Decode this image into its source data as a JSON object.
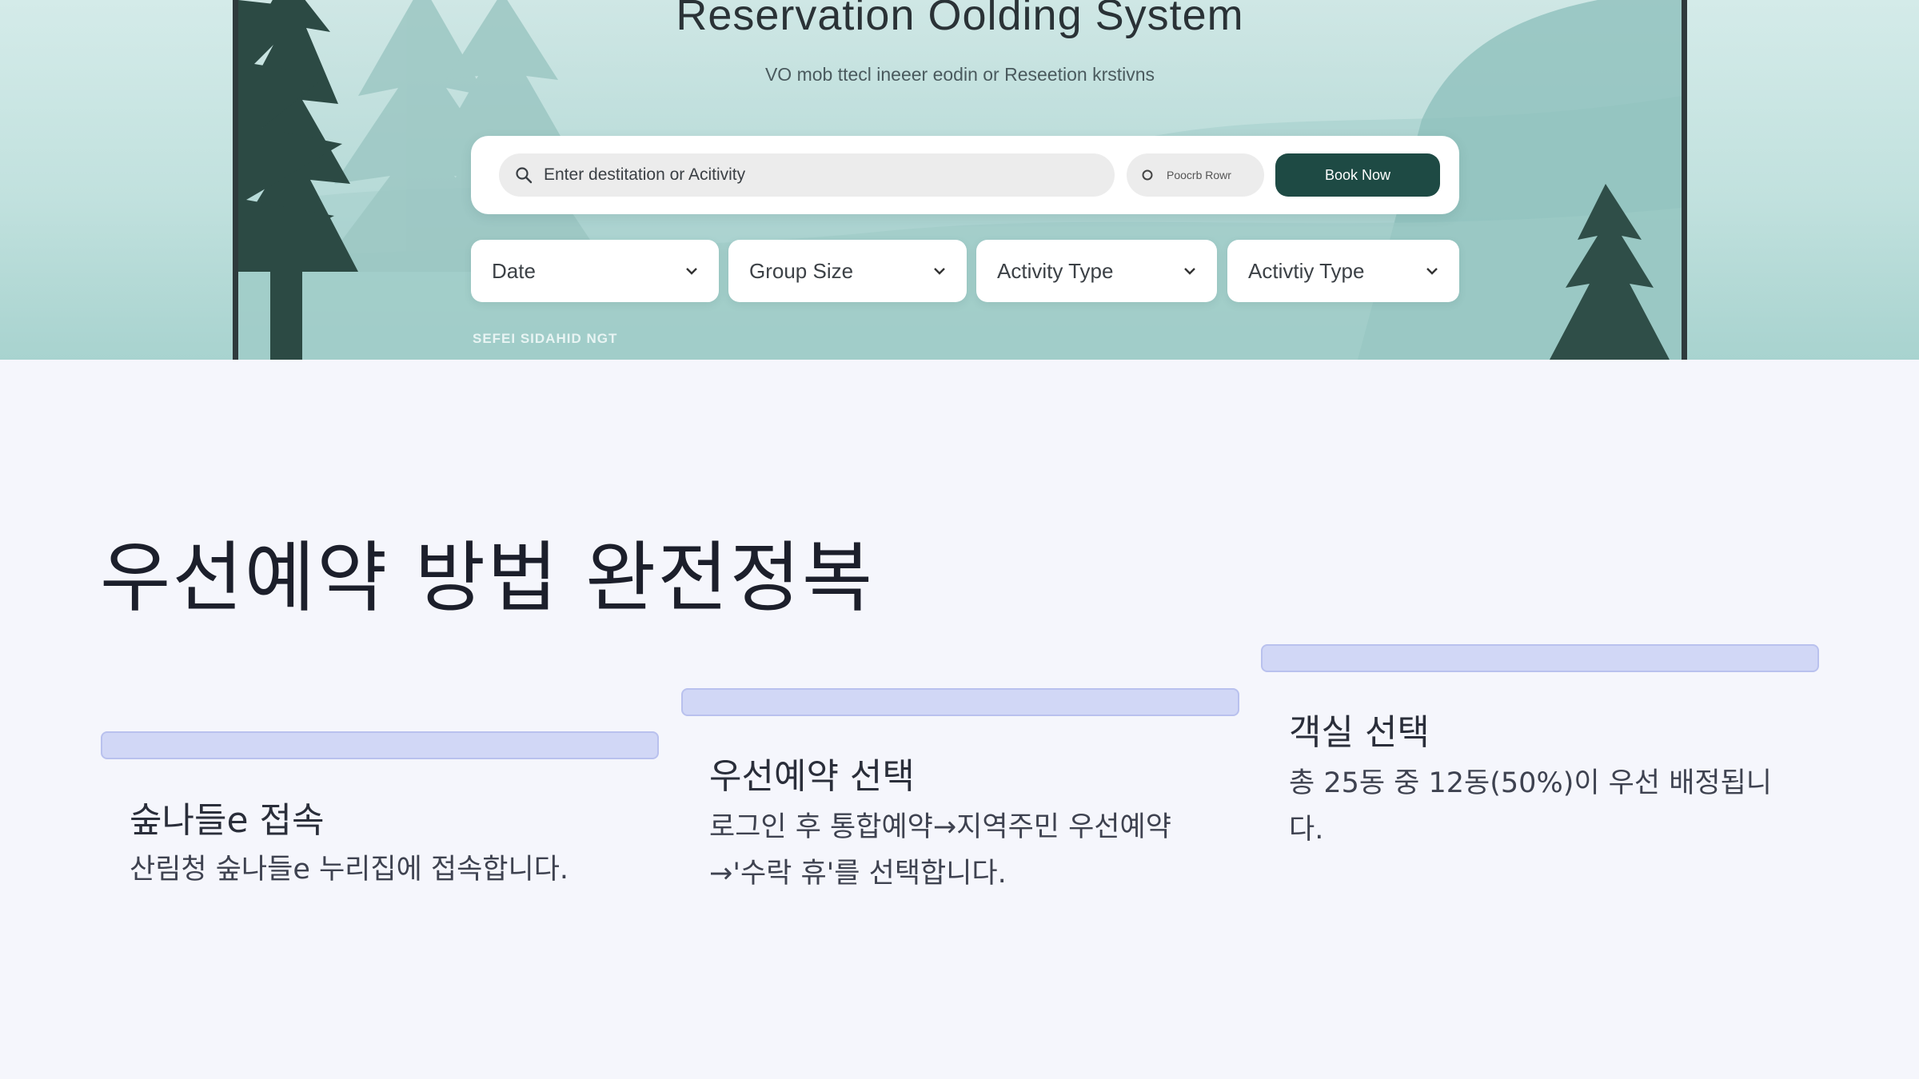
{
  "hero": {
    "title": "Reservation Oolding System",
    "subtitle": "VO mob ttecl ineeer eodin or Reseetion krstivns",
    "search_placeholder": "Enter destitation or Acitivity",
    "secondary_label": "Poocrb Rowr",
    "book_button": "Book Now",
    "filters": [
      {
        "label": "Date",
        "icon": "chevron-down-icon"
      },
      {
        "label": "Group Size",
        "icon": "chevron-down-icon"
      },
      {
        "label": "Activity Type",
        "icon": "chevron-down-icon"
      },
      {
        "label": "Activtiy Type",
        "icon": "chevron-down-icon"
      }
    ],
    "footer_text": "SEFEI SIDAHID NGT",
    "colors": {
      "frame": "#2e3a3c",
      "button": "#1e4a44",
      "tree": "#2c4a44"
    }
  },
  "content": {
    "title": "우선예약 방법 완전정복",
    "accent_color": "#d1d7f6",
    "steps": [
      {
        "title": "숲나들e 접속",
        "desc_lines": [
          "산림청 숲나들e 누리집에 접속합니다."
        ]
      },
      {
        "title": "우선예약 선택",
        "desc_lines": [
          "로그인 후 통합예약→지역주민 우선예약",
          "→'수락 휴'를 선택합니다."
        ]
      },
      {
        "title": "객실 선택",
        "desc_lines": [
          "총 25동 중 12동(50%)이 우선 배정됩니",
          "다."
        ]
      }
    ]
  }
}
